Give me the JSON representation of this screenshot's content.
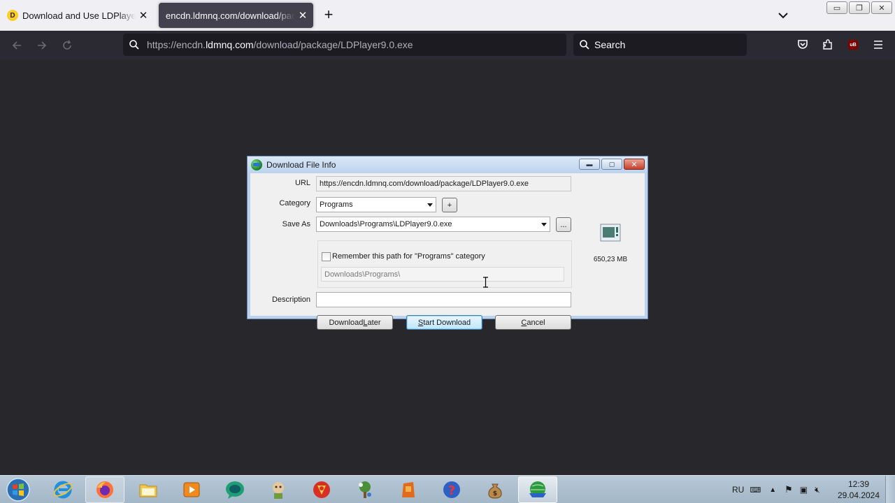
{
  "browser": {
    "tabs": [
      {
        "title": "Download and Use LDPlayer on",
        "favicon": "ldplayer-logo",
        "favicon_letter": "D"
      },
      {
        "title": "encdn.ldmnq.com/download/package"
      }
    ],
    "newtab_label": "+",
    "url": {
      "prefix": "https://encdn.",
      "host": "ldmnq.com",
      "suffix": "/download/package/LDPlayer9.0.exe"
    },
    "search_placeholder": "Search",
    "ublock_label": "uB"
  },
  "dialog": {
    "title": "Download File Info",
    "url_label": "URL",
    "url_value": "https://encdn.ldmnq.com/download/package/LDPlayer9.0.exe",
    "category_label": "Category",
    "category_value": "Programs",
    "add_category_label": "+",
    "save_as_label": "Save As",
    "save_as_value": "Downloads\\Programs\\LDPlayer9.0.exe",
    "browse_label": "...",
    "remember_label": "Remember this path for \"Programs\" category",
    "remember_checked": false,
    "path_value": "Downloads\\Programs\\",
    "description_label": "Description",
    "description_value": "",
    "file_size": "650,23  MB",
    "buttons": {
      "later": {
        "pre": "Download ",
        "key": "L",
        "post": "ater"
      },
      "start": {
        "pre": "",
        "key": "S",
        "post": "tart Download"
      },
      "cancel": {
        "pre": "",
        "key": "C",
        "post": "ancel"
      }
    }
  },
  "taskbar": {
    "apps": [
      "internet-explorer",
      "firefox",
      "file-explorer",
      "media-player",
      "app-green",
      "app-character",
      "app-red-round",
      "app-tree",
      "app-orange",
      "app-question",
      "app-moneybag",
      "internet-download-manager"
    ],
    "language": "RU",
    "time": "12:39",
    "date": "29.04.2024"
  },
  "colors": {
    "page_bg": "#28272c",
    "tabstrip_bg": "#f0f0f4",
    "active_tab_bg": "#42414d",
    "navbar_bg": "#2b2a33",
    "dialog_frame": "#bcd3ed"
  }
}
